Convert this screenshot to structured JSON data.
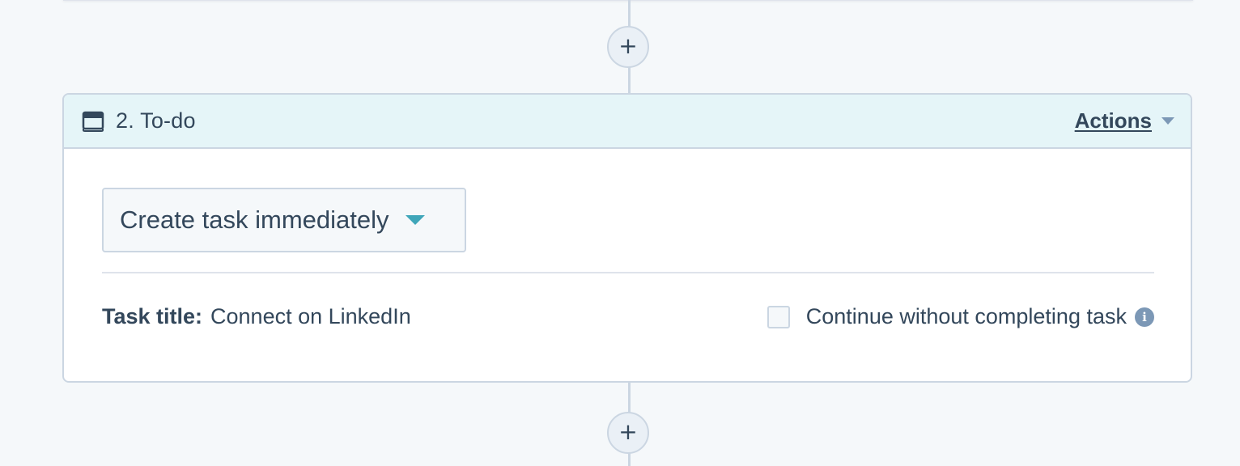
{
  "step": {
    "title": "2. To-do",
    "actions_label": "Actions",
    "add_step_symbol": "+",
    "icon": "calendar-card-icon"
  },
  "task": {
    "timing_select_value": "Create task immediately",
    "title_label": "Task title:",
    "title_value": "Connect on LinkedIn",
    "continue_label": "Continue without completing task",
    "continue_checked": false,
    "info_symbol": "i"
  },
  "colors": {
    "background": "#f5f8fa",
    "header_bg": "#e5f5f8",
    "border": "#cbd6e2",
    "text": "#33475b",
    "accent_caret": "#3fa6b9",
    "muted": "#7c98b6"
  }
}
